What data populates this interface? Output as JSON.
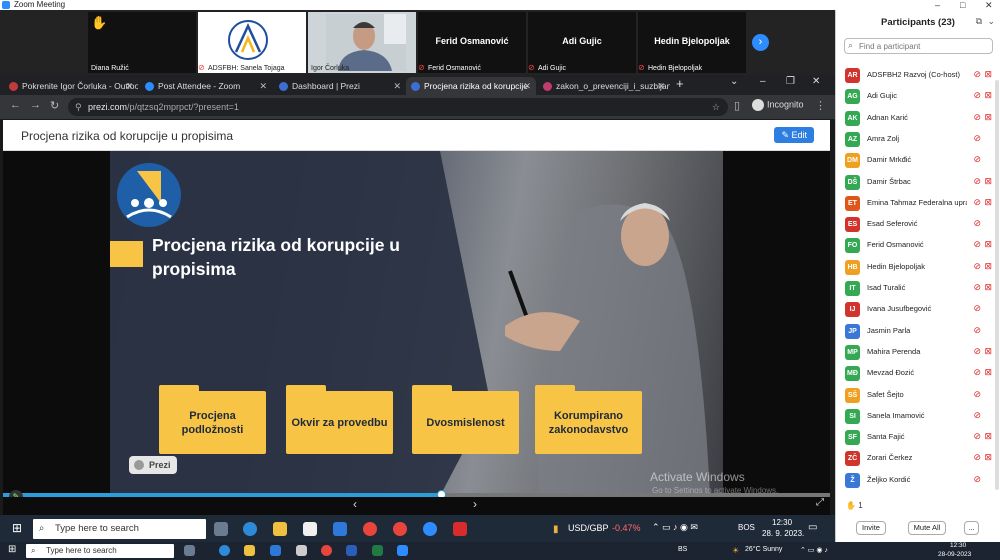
{
  "zoom": {
    "window_title": "Zoom Meeting"
  },
  "videos": [
    {
      "name": "Diana Ružić",
      "muted": false,
      "style": "hand"
    },
    {
      "name": "ADSFBH: Sanela Tojaga",
      "muted": true,
      "style": "logo"
    },
    {
      "name": "Igor Čorluka",
      "muted": false,
      "style": "person"
    },
    {
      "name": "Ferid Osmanović",
      "muted": true,
      "style": "text"
    },
    {
      "name": "Adi Gujic",
      "muted": true,
      "style": "text"
    },
    {
      "name": "Hedin Bjelopoljak",
      "muted": true,
      "style": "text"
    }
  ],
  "browser": {
    "tabs": [
      {
        "label": "Pokrenite Igor Čorluka - Outlook",
        "color": "#c23b3b"
      },
      {
        "label": "Post Attendee - Zoom",
        "color": "#2d8cff"
      },
      {
        "label": "Dashboard | Prezi",
        "color": "#3b6fd1"
      },
      {
        "label": "Procjena rizika od korupcije",
        "color": "#3b6fd1",
        "active": true
      },
      {
        "label": "zakon_o_prevenciji_i_suzbijanju",
        "color": "#c23b6f"
      }
    ],
    "url_host": "prezi.com",
    "url_path": "/p/qtzsq2mprpct/?present=1",
    "incognito": "Incognito"
  },
  "prezi": {
    "title": "Procjena rizika od korupcije u propisima",
    "edit_label": "Edit",
    "slide_title": "Procjena rizika od korupcije u propisima",
    "folders": [
      "Procjena podložnosti",
      "Okvir za provedbu",
      "Dvosmislenost",
      "Korumpirano zakonodavstvo"
    ],
    "badge": "Prezi",
    "progress": 0.53
  },
  "activation": {
    "title": "Activate Windows",
    "subtitle": "Go to Settings to activate Windows."
  },
  "taskbar": {
    "search_placeholder": "Type here to search",
    "ticker": "USD/GBP",
    "ticker_change": "-0.47%",
    "lang": "BOS",
    "time": "12:30",
    "date": "28. 9. 2023."
  },
  "taskbar_outer": {
    "search_placeholder": "Type here to search",
    "lang": "BS",
    "weather": "26°C  Sunny",
    "time": "12:30",
    "date": "28-09-2023"
  },
  "participants": {
    "title": "Participants (23)",
    "search_placeholder": "Find a participant",
    "list": [
      {
        "initials": "AR",
        "name": "ADSFBH2 Razvoj (Co-host)",
        "color": "#d0342c",
        "cam_off": true
      },
      {
        "initials": "AG",
        "name": "Adi Gujic",
        "color": "#35a853",
        "cam_off": true
      },
      {
        "initials": "AK",
        "name": "Adnan Karić",
        "color": "#35a853",
        "cam_off": true
      },
      {
        "initials": "AZ",
        "name": "Amra Zolj",
        "color": "#35a853",
        "cam_off": false
      },
      {
        "initials": "DM",
        "name": "Damir Mrkđić",
        "color": "#f0a020",
        "cam_off": false
      },
      {
        "initials": "DŠ",
        "name": "Damir Štrbac",
        "color": "#35a853",
        "cam_off": true
      },
      {
        "initials": "ET",
        "name": "Emina Tahmaz Federalna uprav...",
        "color": "#e0561a",
        "cam_off": true
      },
      {
        "initials": "ES",
        "name": "Esad Seferović",
        "color": "#d0342c",
        "cam_off": false
      },
      {
        "initials": "FO",
        "name": "Ferid Osmanović",
        "color": "#35a853",
        "cam_off": true
      },
      {
        "initials": "HB",
        "name": "Hedin Bjelopoljak",
        "color": "#f0a020",
        "cam_off": true
      },
      {
        "initials": "IT",
        "name": "Isad Turalić",
        "color": "#35a853",
        "cam_off": true
      },
      {
        "initials": "IJ",
        "name": "Ivana Jusufbegović",
        "color": "#d0342c",
        "cam_off": false
      },
      {
        "initials": "JP",
        "name": "Jasmin Parla",
        "color": "#3a78d8",
        "cam_off": false
      },
      {
        "initials": "MP",
        "name": "Mahira Perenda",
        "color": "#35a853",
        "cam_off": true
      },
      {
        "initials": "MĐ",
        "name": "Mevzad Đozić",
        "color": "#35a853",
        "cam_off": true
      },
      {
        "initials": "SŠ",
        "name": "Safet Šejto",
        "color": "#f0a020",
        "cam_off": false
      },
      {
        "initials": "SI",
        "name": "Sanela Imamović",
        "color": "#35a853",
        "cam_off": false
      },
      {
        "initials": "SF",
        "name": "Santa Fajić",
        "color": "#35a853",
        "cam_off": true
      },
      {
        "initials": "ZČ",
        "name": "Zorari Čerkez",
        "color": "#d0342c",
        "cam_off": true
      },
      {
        "initials": "Ž",
        "name": "Željko Kordić",
        "color": "#3a78d8",
        "cam_off": false
      }
    ],
    "raised_count": "1",
    "invite_label": "Invite",
    "mute_all_label": "Mute All",
    "more_label": "..."
  }
}
